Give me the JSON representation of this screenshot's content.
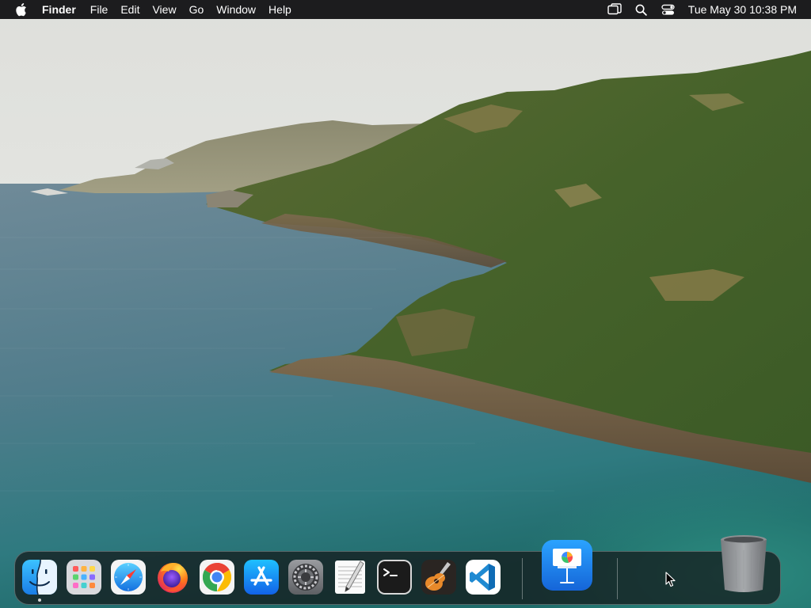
{
  "menubar": {
    "apple_menu_icon": "apple-icon",
    "app_name": "Finder",
    "menus": [
      "File",
      "Edit",
      "View",
      "Go",
      "Window",
      "Help"
    ],
    "status_icons": [
      "screen-mirroring-icon",
      "spotlight-search-icon",
      "control-center-icon"
    ],
    "clock": "Tue May 30  10:38 PM"
  },
  "dock": {
    "apps": [
      {
        "name": "Finder",
        "icon": "finder-icon",
        "running": true
      },
      {
        "name": "Launchpad",
        "icon": "launchpad-icon",
        "running": false
      },
      {
        "name": "Safari",
        "icon": "safari-icon",
        "running": false
      },
      {
        "name": "Firefox",
        "icon": "firefox-icon",
        "running": false
      },
      {
        "name": "Google Chrome",
        "icon": "chrome-icon",
        "running": false
      },
      {
        "name": "App Store",
        "icon": "app-store-icon",
        "running": false
      },
      {
        "name": "System Preferences",
        "icon": "system-preferences-icon",
        "running": false
      },
      {
        "name": "TextEdit",
        "icon": "textedit-icon",
        "running": false
      },
      {
        "name": "Terminal",
        "icon": "terminal-icon",
        "running": false
      },
      {
        "name": "GarageBand",
        "icon": "garageband-icon",
        "running": false
      },
      {
        "name": "Visual Studio Code",
        "icon": "vscode-icon",
        "running": false
      },
      {
        "name": "Keynote",
        "icon": "keynote-icon",
        "running": false
      }
    ],
    "trash": {
      "name": "Trash",
      "icon": "trash-icon"
    }
  },
  "colors": {
    "menubar_bg": "#1c1c1e",
    "dock_bg": "#141618",
    "sea": "#3f7f8c",
    "hills": "#4f6a2c"
  }
}
